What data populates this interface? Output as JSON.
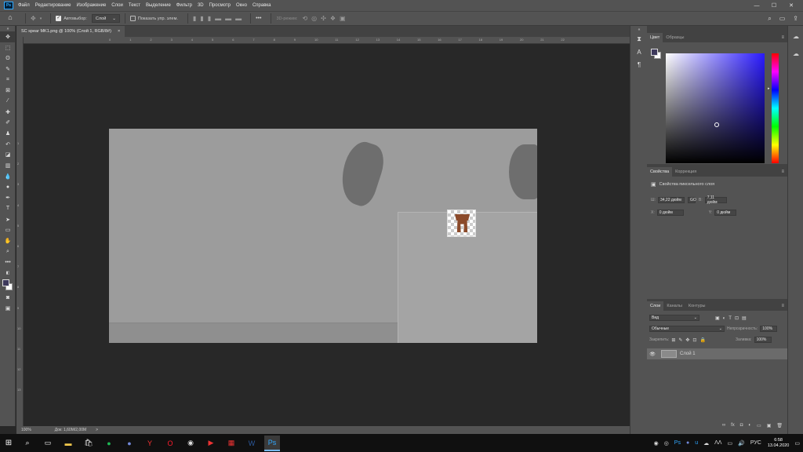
{
  "app": {
    "logo": "Ps"
  },
  "menubar": {
    "items": [
      "Файл",
      "Редактирование",
      "Изображение",
      "Слои",
      "Текст",
      "Выделение",
      "Фильтр",
      "3D",
      "Просмотр",
      "Окно",
      "Справка"
    ],
    "window_controls": [
      "—",
      "☐",
      "✕"
    ]
  },
  "optionsbar": {
    "autoselect_label": "Автовыбор:",
    "autoselect_value": "Слой",
    "show_controls_label": "Показать упр. элем.",
    "mode_3d_label": "3D-режим:",
    "more": "•••"
  },
  "document": {
    "tab_title": "SC spear MK1.png @ 100% (Слой 1, RGB/8#)",
    "tab_close": "×",
    "ruler_top_ticks": [
      "0",
      "1",
      "2",
      "3",
      "4",
      "5",
      "6",
      "7",
      "8",
      "9",
      "10",
      "11",
      "12",
      "13",
      "14",
      "15",
      "16",
      "17",
      "18",
      "19",
      "20",
      "21",
      "22"
    ],
    "ruler_left_ticks": [
      "1",
      "2",
      "3",
      "4",
      "5",
      "6",
      "7",
      "8",
      "9",
      "10",
      "11",
      "12",
      "13"
    ]
  },
  "statusbar": {
    "zoom": "100%",
    "doc_info": "Док: 1,60M/2,00M",
    "arrow": ">"
  },
  "color_panel": {
    "tabs": [
      "Цвет",
      "Образцы"
    ],
    "foreground": "#3e3a5c",
    "background": "#ffffff"
  },
  "properties_panel": {
    "tabs": [
      "Свойства",
      "Коррекция"
    ],
    "subtitle": "Свойства пиксельного слоя",
    "w_label": "Ш:",
    "w_value": "34,22 дюйм",
    "link": "GO",
    "h_label": "В:",
    "h_value": "7,11 дюйм",
    "x_label": "X:",
    "x_value": "0 дюйм",
    "y_label": "Y:",
    "y_value": "0 дюйм"
  },
  "layers_panel": {
    "tabs": [
      "Слои",
      "Каналы",
      "Контуры"
    ],
    "filter_kind": "Вид",
    "blend_mode": "Обычные",
    "opacity_label": "Непрозрачность:",
    "opacity_value": "100%",
    "lock_label": "Закрепить:",
    "fill_label": "Заливка:",
    "fill_value": "100%",
    "layers": [
      {
        "name": "Слой 1",
        "visible": true
      }
    ],
    "bottom_icons": [
      "∞",
      "fx",
      "◘",
      "◐",
      "▭",
      "▣",
      "🗑"
    ]
  },
  "taskbar": {
    "tray": [
      "ΛΛ",
      "РУС"
    ],
    "time": "6:58",
    "date": "13.04.2020"
  }
}
